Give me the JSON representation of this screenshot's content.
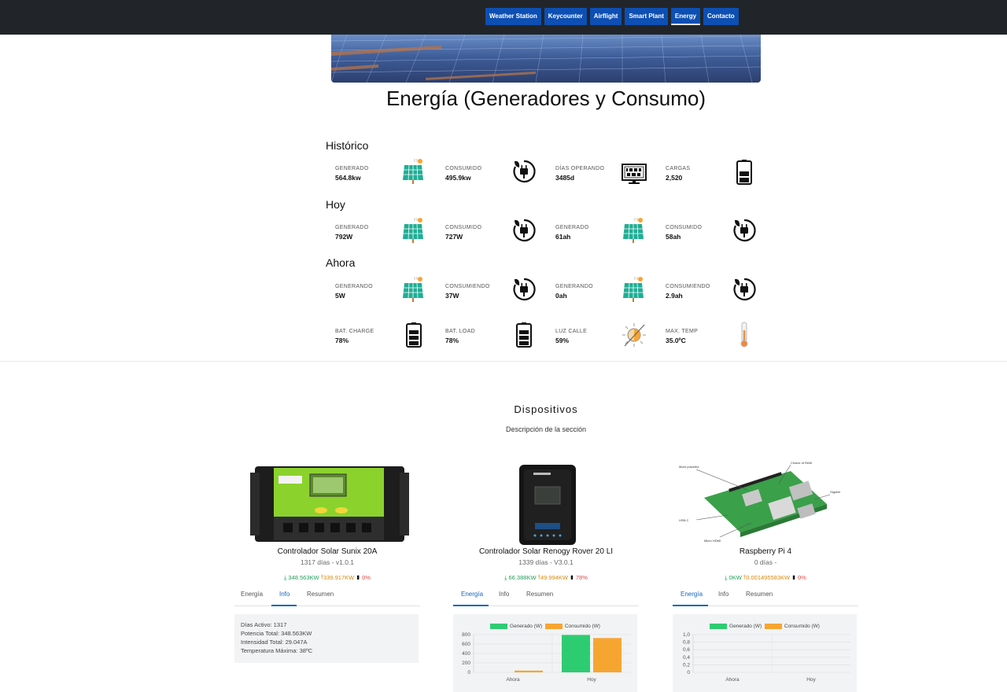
{
  "nav": {
    "items": [
      "Weather Station",
      "Keycounter",
      "Airflight",
      "Smart Plant",
      "Energy",
      "Contacto"
    ],
    "active": "Energy"
  },
  "page_title": "Energía (Generadores y Consumo)",
  "sections": {
    "historico": {
      "title": "Histórico",
      "stats": [
        {
          "label": "GENERADO",
          "value": "564.8kw",
          "icon": "solar-panel-icon"
        },
        {
          "label": "CONSUMIDO",
          "value": "495.9kw",
          "icon": "plug-icon"
        },
        {
          "label": "DÍAS OPERANDO",
          "value": "3485d",
          "icon": "monitor-counter-icon"
        },
        {
          "label": "CARGAS",
          "value": "2,520",
          "icon": "battery-icon"
        }
      ]
    },
    "hoy": {
      "title": "Hoy",
      "stats": [
        {
          "label": "GENERADO",
          "value": "792W",
          "icon": "solar-panel-icon"
        },
        {
          "label": "CONSUMIDO",
          "value": "727W",
          "icon": "plug-icon"
        },
        {
          "label": "GENERADO",
          "value": "61ah",
          "icon": "solar-panel-icon"
        },
        {
          "label": "CONSUMIDO",
          "value": "58ah",
          "icon": "plug-icon"
        }
      ]
    },
    "ahora": {
      "title": "Ahora",
      "stats": [
        {
          "label": "GENERANDO",
          "value": "5W",
          "icon": "solar-panel-icon"
        },
        {
          "label": "CONSUMIENDO",
          "value": "37W",
          "icon": "plug-icon"
        },
        {
          "label": "GENERANDO",
          "value": "0ah",
          "icon": "solar-panel-icon"
        },
        {
          "label": "CONSUMIENDO",
          "value": "2.9ah",
          "icon": "plug-icon"
        },
        {
          "label": "BAT. CHARGE",
          "value": "78%",
          "icon": "battery-icon"
        },
        {
          "label": "BAT. LOAD",
          "value": "78%",
          "icon": "battery-icon"
        },
        {
          "label": "LUZ CALLE",
          "value": "59%",
          "icon": "street-light-icon"
        },
        {
          "label": "MAX. TEMP",
          "value": "35.0ºC",
          "icon": "thermometer-icon"
        }
      ]
    }
  },
  "dispositivos": {
    "title": "Dispositivos",
    "subtitle": "Descripción de la sección",
    "tabs": [
      "Energía",
      "Info",
      "Resumen"
    ],
    "legend": {
      "generated": "Generado (W)",
      "consumed": "Consumido (W)"
    },
    "devices": [
      {
        "name": "Controlador Solar Sunix 20A",
        "meta": "1317 días - v1.0.1",
        "generated": "348.563KW",
        "consumed": "339.917KW",
        "battery": "0%",
        "active_tab": "Info",
        "info": [
          "Días Activo: 1317",
          "Potencia Total: 348.563KW",
          "Intensidad Total: 29.047A",
          "Temperatura Máxima: 38ºC"
        ]
      },
      {
        "name": "Controlador Solar Renogy Rover 20 LI",
        "meta": "1339 días - V3.0.1",
        "generated": "66.388KW",
        "consumed": "49.994KW",
        "battery": "78%",
        "active_tab": "Energía"
      },
      {
        "name": "Raspberry Pi 4",
        "meta": "0 días -",
        "generated": "0KW",
        "consumed": "0.001495583KW",
        "battery": "0%",
        "active_tab": "Energía"
      }
    ]
  },
  "chart_data": [
    {
      "type": "bar",
      "categories": [
        "Ahora",
        "Hoy"
      ],
      "series": [
        {
          "name": "Generado (W)",
          "values": [
            0,
            792
          ],
          "color": "#2ecc71"
        },
        {
          "name": "Consumido (W)",
          "values": [
            37,
            727
          ],
          "color": "#f7a531"
        }
      ],
      "ylim": [
        0,
        800
      ],
      "yticks": [
        "800",
        "600",
        "400",
        "200",
        "0"
      ],
      "legend": "top"
    },
    {
      "type": "bar",
      "categories": [
        "Ahora",
        "Hoy"
      ],
      "series": [
        {
          "name": "Generado (W)",
          "values": [
            0,
            0
          ],
          "color": "#2ecc71"
        },
        {
          "name": "Consumido (W)",
          "values": [
            0,
            0
          ],
          "color": "#f7a531"
        }
      ],
      "ylim": [
        0,
        1
      ],
      "yticks": [
        "1,0",
        "0,8",
        "0,6",
        "0,4",
        "0,2",
        "0"
      ],
      "legend": "top"
    }
  ]
}
